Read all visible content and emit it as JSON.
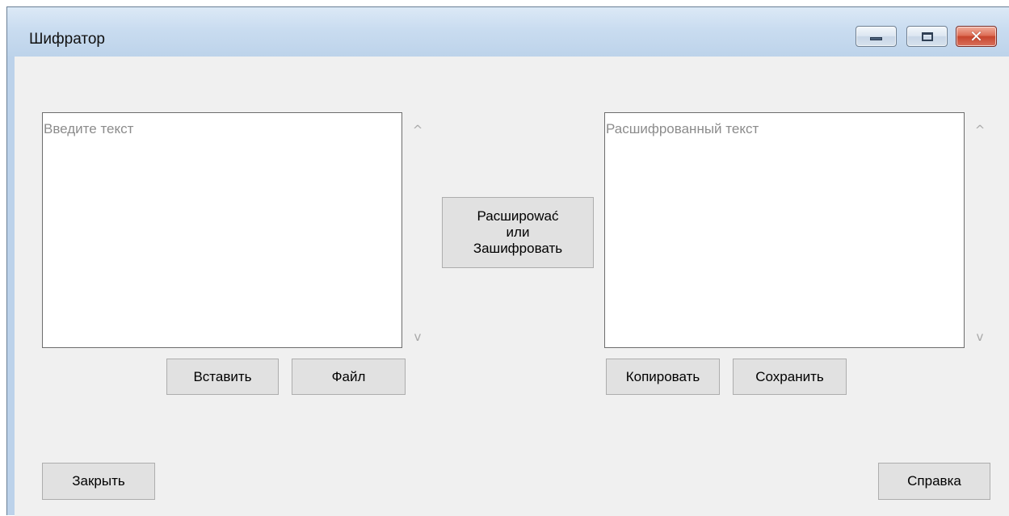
{
  "window": {
    "title": "Шифратор"
  },
  "input": {
    "placeholder": "Введите текст",
    "value": ""
  },
  "output": {
    "placeholder": "Расшифрованный текст",
    "value": ""
  },
  "buttons": {
    "insert": "Вставить",
    "file": "Файл",
    "crypt_line1": "Расширować",
    "crypt_line2": "или",
    "crypt_line3": "Зашифровать",
    "copy": "Копировать",
    "save": "Сохранить",
    "close": "Закрыть",
    "help": "Справка"
  },
  "icons": {
    "minimize": "minimize-icon",
    "maximize": "maximize-icon",
    "close": "close-icon",
    "scroll_up": "chevron-up-icon",
    "scroll_down": "chevron-down-icon"
  }
}
